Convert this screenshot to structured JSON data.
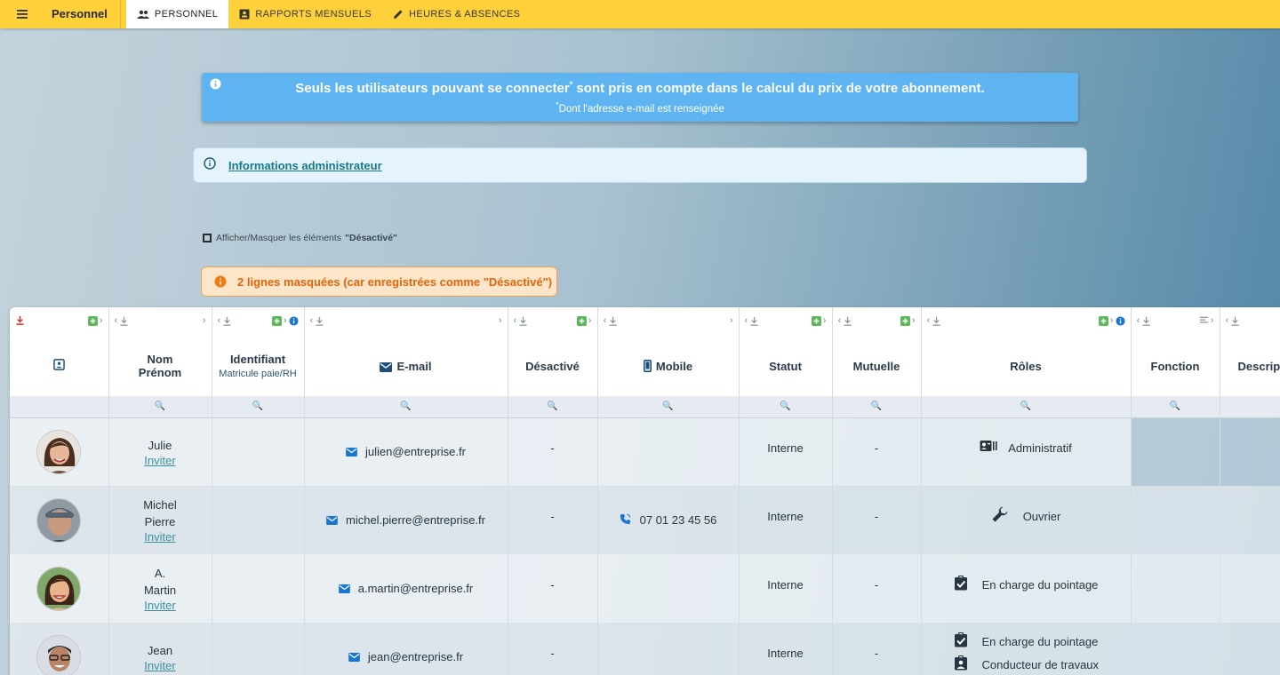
{
  "topbar": {
    "app_title": "Personnel",
    "tabs": [
      {
        "label": "PERSONNEL",
        "icon": "people-icon",
        "active": true
      },
      {
        "label": "RAPPORTS MENSUELS",
        "icon": "report-icon",
        "active": false
      },
      {
        "label": "HEURES & ABSENCES",
        "icon": "pencil-icon",
        "active": false
      }
    ]
  },
  "banner": {
    "main_before": "Seuls les utilisateurs pouvant se connecter",
    "main_sup": "*",
    "main_after": " sont pris en compte dans le calcul du prix de votre abonnement.",
    "sub_sup": "*",
    "sub": "Dont l'adresse e-mail est renseignée"
  },
  "admin_info": {
    "link": "Informations administrateur"
  },
  "toggle": {
    "label": "Afficher/Masquer les éléments",
    "value": "\"Désactivé\""
  },
  "hidden_warning": "2 lignes masquées (car enregistrées comme \"Désactivé\")",
  "table": {
    "headers": {
      "name": "Nom",
      "firstname": "Prénom",
      "identifiant": "Identifiant",
      "identifiant_sub": "Matricule paie/RH",
      "email": "E-mail",
      "desactive": "Désactivé",
      "mobile": "Mobile",
      "statut": "Statut",
      "mutuelle": "Mutuelle",
      "roles": "Rôles",
      "fonction": "Fonction",
      "description": "Descripti"
    },
    "filter_glyph": "🔍",
    "invite_label": "Inviter",
    "rows": [
      {
        "name": "Julie",
        "email": "julien@entreprise.fr",
        "desactive": "-",
        "mobile": "",
        "statut": "Interne",
        "mutuelle": "-",
        "roles": [
          "Administratif"
        ]
      },
      {
        "name": "Michel",
        "name2": "Pierre",
        "email": "michel.pierre@entreprise.fr",
        "desactive": "-",
        "mobile": "07 01 23 45 56",
        "statut": "Interne",
        "mutuelle": "-",
        "roles": [
          "Ouvrier"
        ]
      },
      {
        "name": "A.",
        "name2": "Martin",
        "email": "a.martin@entreprise.fr",
        "desactive": "-",
        "mobile": "",
        "statut": "Interne",
        "mutuelle": "-",
        "roles": [
          "En charge du pointage"
        ]
      },
      {
        "name": "Jean",
        "email": "jean@entreprise.fr",
        "desactive": "-",
        "mobile": "",
        "statut": "Interne",
        "mutuelle": "-",
        "roles": [
          "En charge du pointage",
          "Conducteur de travaux"
        ]
      }
    ]
  },
  "colors": {
    "topbar": "#fed03a",
    "banner": "#5eb4f1",
    "warning_text": "#e0650b",
    "link": "#147a8a",
    "plus_green": "#5cb85c",
    "info_blue": "#1976d2",
    "download_red": "#d32f2f"
  }
}
